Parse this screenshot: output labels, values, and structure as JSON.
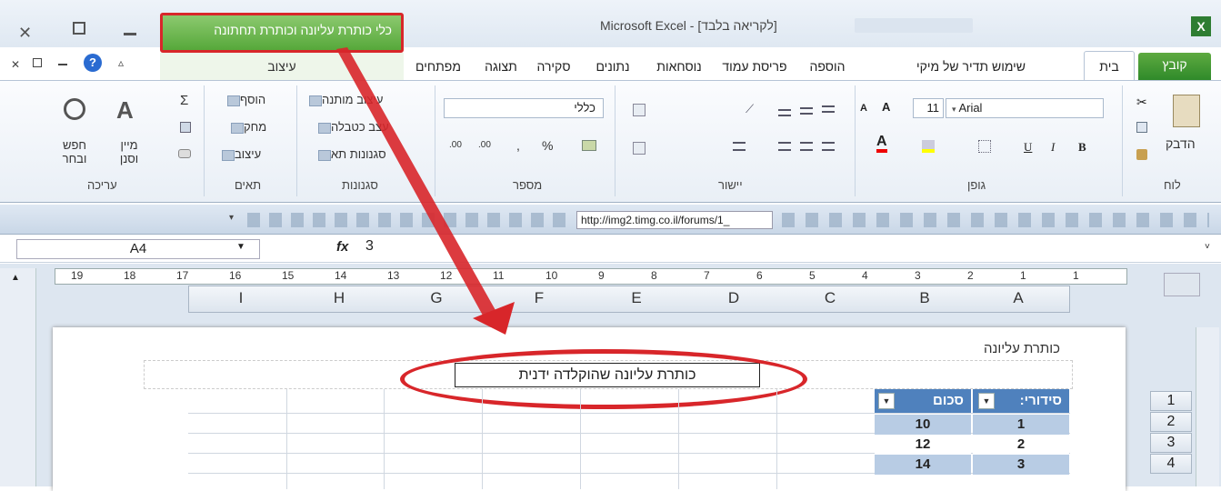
{
  "window": {
    "title": "Microsoft Excel - [לקריאה בלבד]",
    "context_tab_title": "כלי כותרת עליונה וכותרת תחתונה"
  },
  "tabs": {
    "file": "קובץ",
    "home": "בית",
    "tdir": "שימוש תדיר של מיקי",
    "insert": "הוספה",
    "page_layout": "פריסת עמוד",
    "formulas": "נוסחאות",
    "data": "נתונים",
    "review": "סקירה",
    "view": "תצוגה",
    "developer": "מפתחים",
    "design": "עיצוב"
  },
  "ribbon": {
    "clipboard": {
      "label": "לוח",
      "paste": "הדבק"
    },
    "font": {
      "label": "גופן",
      "name": "Arial",
      "size": "11"
    },
    "alignment": {
      "label": "יישור"
    },
    "number": {
      "label": "מספר",
      "format": "כללי"
    },
    "styles": {
      "label": "סגנונות",
      "conditional": "עיצוב מותנה",
      "table": "עצב כטבלה",
      "cell": "סגנונות תא"
    },
    "cells": {
      "label": "תאים",
      "insert": "הוסף",
      "delete": "מחק",
      "format": "עיצוב"
    },
    "editing": {
      "label": "עריכה",
      "sort": "מיין וסנן",
      "find": "חפש ובחר"
    }
  },
  "qat": {
    "url": "http://img2.timg.co.il/forums/1_"
  },
  "formula_bar": {
    "name_box": "A4",
    "fx": "fx",
    "value": "3"
  },
  "ruler": {
    "numbers": [
      "19",
      "18",
      "17",
      "16",
      "15",
      "14",
      "13",
      "12",
      "11",
      "10",
      "9",
      "8",
      "7",
      "6",
      "5",
      "4",
      "3",
      "2",
      "1",
      "1"
    ]
  },
  "columns": [
    "I",
    "H",
    "G",
    "F",
    "E",
    "D",
    "C",
    "B",
    "A"
  ],
  "header": {
    "label": "כותרת עליונה",
    "custom_text": "כותרת עליונה שהוקלדה ידנית"
  },
  "table": {
    "headers": [
      "סידורי:",
      "סכום"
    ],
    "rows": [
      [
        "1",
        "10"
      ],
      [
        "2",
        "12"
      ],
      [
        "3",
        "14"
      ]
    ]
  },
  "row_numbers": [
    "1",
    "2",
    "3",
    "4"
  ],
  "colors": {
    "accent_green": "#56a83a",
    "highlight_red": "#d8262a",
    "table_header": "#4f81bd",
    "table_cell": "#b8cce4"
  }
}
